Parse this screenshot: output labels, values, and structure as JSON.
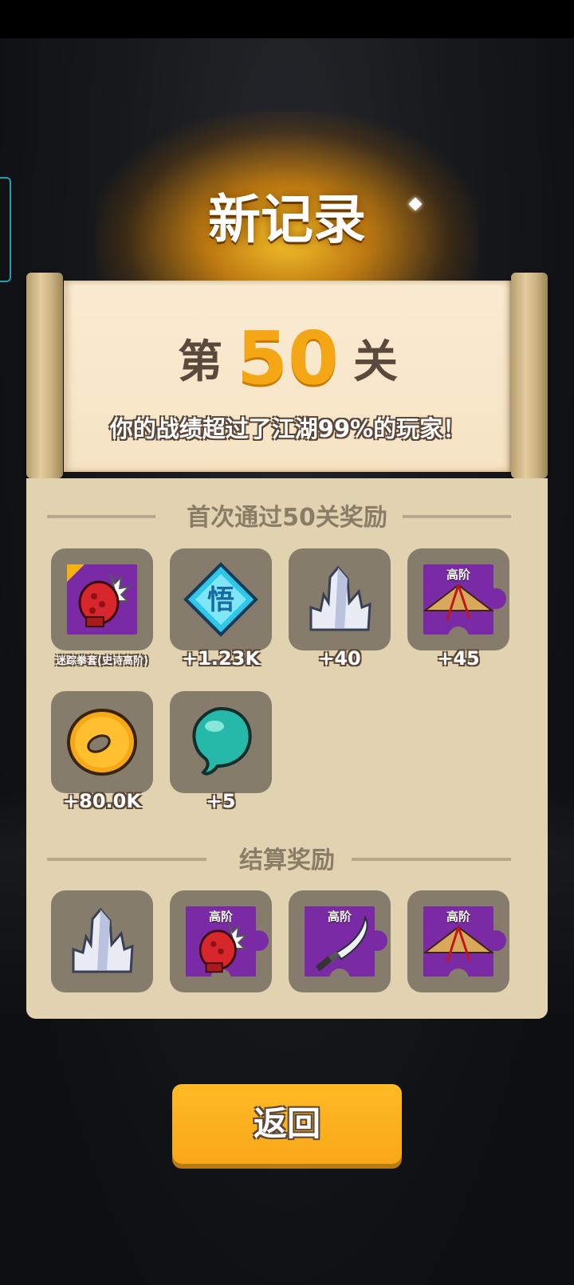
{
  "header": {
    "title": "新记录"
  },
  "level": {
    "prefix": "第",
    "number": "50",
    "suffix": "关",
    "subtitle": "你的战绩超过了江湖99%的玩家！"
  },
  "first_clear": {
    "title": "首次通过50关奖励",
    "items": [
      {
        "icon": "red-gauntlet-icon",
        "label": "迷踪拳套(史诗高阶)",
        "tier": "高阶"
      },
      {
        "icon": "blue-diamond-wu-icon",
        "label": "+1.23K",
        "glyph": "悟"
      },
      {
        "icon": "crystal-icon",
        "label": "+40"
      },
      {
        "icon": "straw-hat-puzzle-icon",
        "label": "+45",
        "tier": "高阶"
      },
      {
        "icon": "gold-coin-icon",
        "label": "+80.0K"
      },
      {
        "icon": "jade-droplet-icon",
        "label": "+5"
      }
    ]
  },
  "settlement": {
    "title": "结算奖励",
    "items": [
      {
        "icon": "crystal-icon"
      },
      {
        "icon": "gauntlet-puzzle-icon",
        "tier": "高阶"
      },
      {
        "icon": "sword-puzzle-icon",
        "tier": "高阶"
      },
      {
        "icon": "straw-hat-puzzle-icon",
        "tier": "高阶"
      }
    ]
  },
  "buttons": {
    "back": "返回"
  },
  "colors": {
    "accent": "#f9a81a",
    "level_number": "#f5a614",
    "panel": "#e1d3b0",
    "item_bg": "#857c6c",
    "puzzle": "#7a2aa4"
  }
}
